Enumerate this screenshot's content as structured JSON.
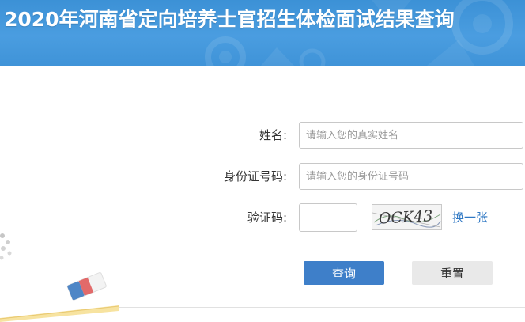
{
  "header": {
    "title": "2020年河南省定向培养士官招生体检面试结果查询"
  },
  "form": {
    "name": {
      "label": "姓名:",
      "placeholder": "请输入您的真实姓名",
      "value": ""
    },
    "id_number": {
      "label": "身份证号码:",
      "placeholder": "请输入您的身份证号码",
      "value": ""
    },
    "captcha": {
      "label": "验证码:",
      "value": "",
      "image_text": "OCK43",
      "refresh_label": "换一张"
    }
  },
  "buttons": {
    "query": "查询",
    "reset": "重置"
  },
  "colors": {
    "banner": "#4a9de0",
    "primary_button": "#3e7fc9",
    "secondary_button": "#e9e9e9",
    "link": "#2f78c4"
  }
}
